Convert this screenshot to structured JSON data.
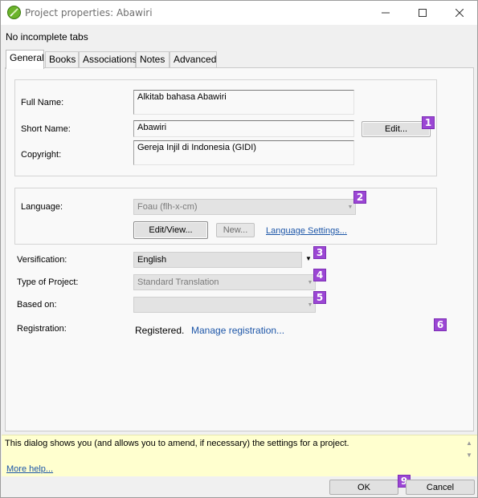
{
  "window": {
    "title": "Project properties: Abawiri",
    "icon": "paratext-leaf-icon",
    "controls": [
      "minimize",
      "maximize",
      "close"
    ]
  },
  "status": {
    "tabs_message": "No incomplete tabs"
  },
  "tabs": [
    {
      "label": "General",
      "active": true
    },
    {
      "label": "Books",
      "active": false
    },
    {
      "label": "Associations",
      "active": false
    },
    {
      "label": "Notes",
      "active": false
    },
    {
      "label": "Advanced",
      "active": false
    }
  ],
  "general": {
    "full_name": {
      "label": "Full Name:",
      "value": "Alkitab bahasa Abawiri"
    },
    "short_name": {
      "label": "Short Name:",
      "value": "Abawiri",
      "edit_button": "Edit..."
    },
    "copyright": {
      "label": "Copyright:",
      "value": "Gereja Injil di Indonesia (GIDI)"
    },
    "language": {
      "label": "Language:",
      "value": "Foau (flh-x-cm)",
      "edit_view_button": "Edit/View...",
      "new_button": "New...",
      "settings_link": "Language Settings..."
    },
    "versification": {
      "label": "Versification:",
      "value": "English"
    },
    "project_type": {
      "label": "Type of Project:",
      "value": "Standard Translation"
    },
    "based_on": {
      "label": "Based on:",
      "value": ""
    },
    "registration": {
      "label": "Registration:",
      "status": "Registered.",
      "manage_link": "Manage registration..."
    }
  },
  "badges": [
    "1",
    "2",
    "3",
    "4",
    "5",
    "6",
    "9"
  ],
  "help": {
    "text": "This dialog shows you (and allows you to amend, if necessary) the settings for a project.",
    "more_link": "More help..."
  },
  "footer": {
    "ok": "OK",
    "cancel": "Cancel"
  },
  "colors": {
    "badge": "#9b46d4",
    "link": "#1d56a8",
    "help_background": "#ffffcf"
  }
}
